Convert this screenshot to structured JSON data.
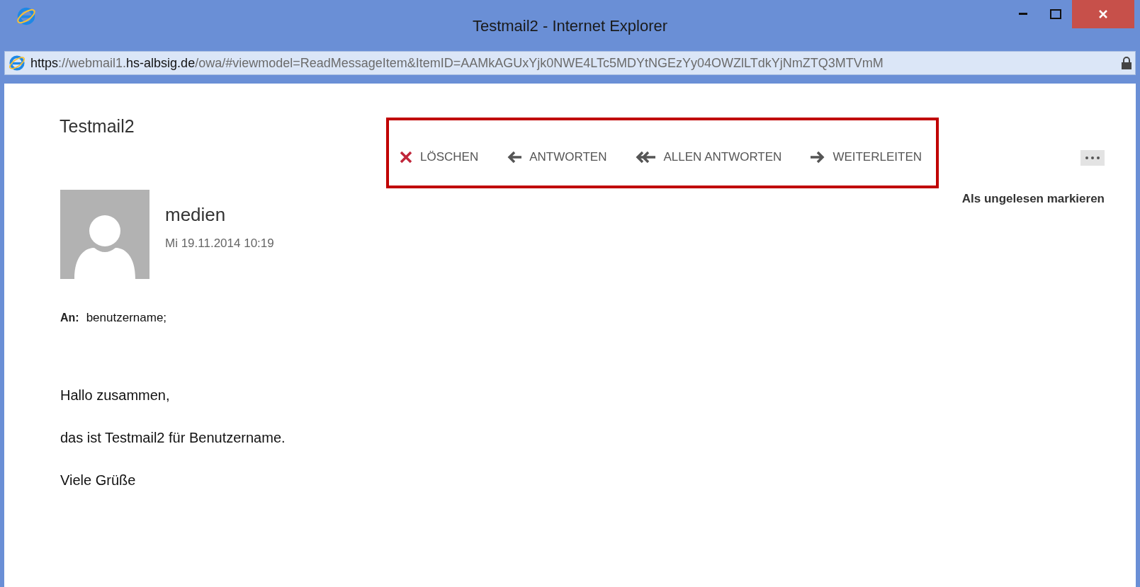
{
  "window": {
    "title": "Testmail2 - Internet Explorer"
  },
  "address_bar": {
    "url_parts": [
      {
        "text": "https",
        "strong": true
      },
      {
        "text": "://webmail1.",
        "strong": false
      },
      {
        "text": "hs-albsig.de",
        "strong": true
      },
      {
        "text": "/owa/#viewmodel=ReadMessageItem&ItemID=AAMkAGUxYjk0NWE4LTc5MDYtNGEzYy04OWZlLTdkYjNmZTQ3MTVmM",
        "strong": false
      }
    ]
  },
  "message": {
    "subject": "Testmail2",
    "actions": [
      {
        "kind": "delete",
        "label": "LÖSCHEN"
      },
      {
        "kind": "reply",
        "label": "ANTWORTEN"
      },
      {
        "kind": "reply_all",
        "label": "ALLEN ANTWORTEN"
      },
      {
        "kind": "forward",
        "label": "WEITERLEITEN"
      }
    ],
    "mark_unread": "Als ungelesen markieren",
    "sender": "medien",
    "date": "Mi 19.11.2014 10:19",
    "to_label": "An:",
    "to": "benutzername;",
    "body": [
      "Hallo zusammen,",
      "das ist Testmail2 für Benutzername.",
      "Viele Grüße"
    ]
  }
}
